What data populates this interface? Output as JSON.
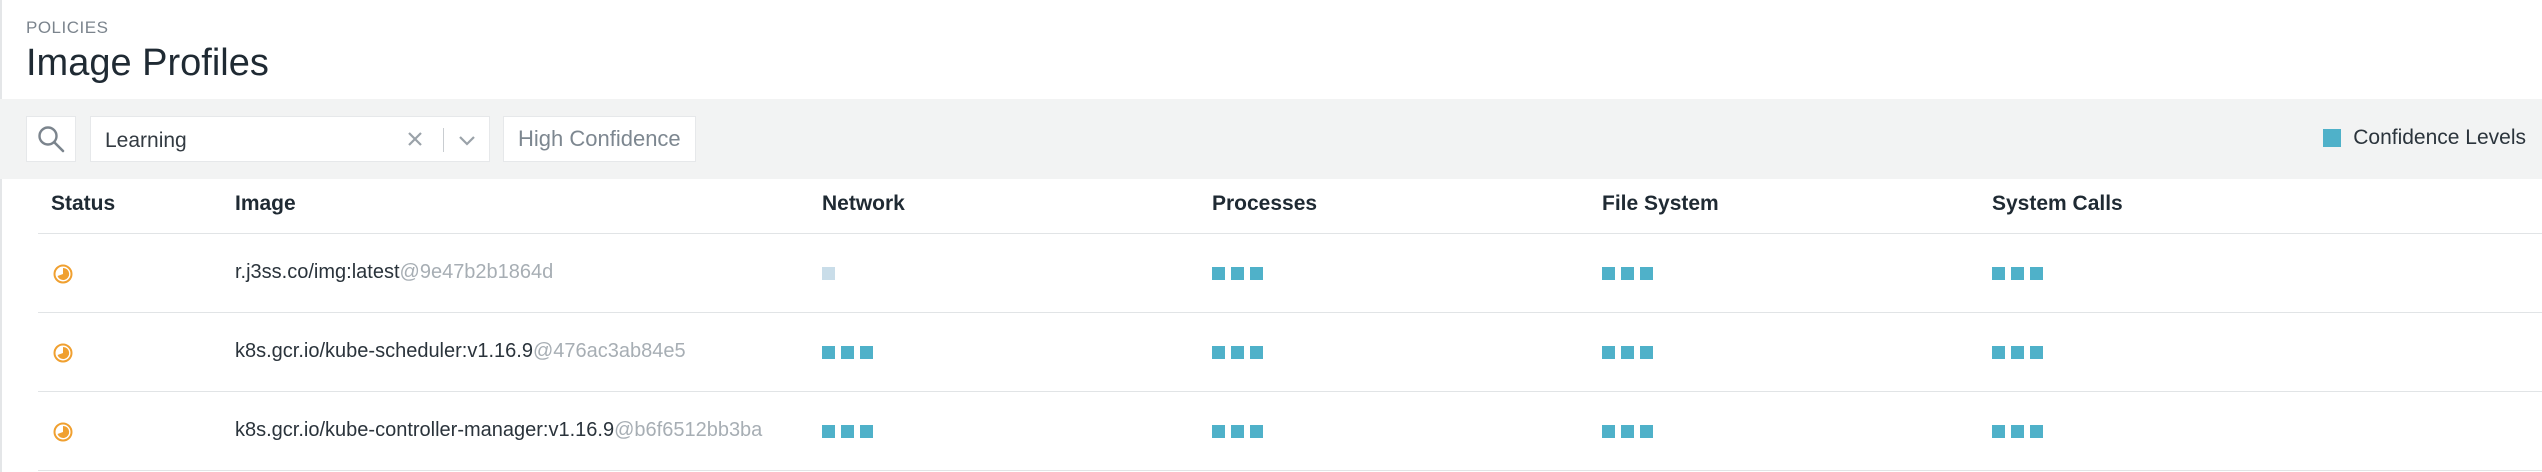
{
  "header": {
    "breadcrumb": "POLICIES",
    "title": "Image Profiles"
  },
  "toolbar": {
    "filter_value": "Learning",
    "confidence_button": "High Confidence",
    "legend_label": "Confidence Levels"
  },
  "colors": {
    "accent": "#4fb1c9",
    "low_confidence": "#c9dde9",
    "status_learning": "#f0a030"
  },
  "table": {
    "columns": [
      "Status",
      "Image",
      "Network",
      "Processes",
      "File System",
      "System Calls"
    ],
    "rows": [
      {
        "status": "learning",
        "image": "r.j3ss.co/img:latest",
        "hash": "@9e47b2b1864d",
        "network": 1,
        "processes": 3,
        "file_system": 3,
        "system_calls": 3
      },
      {
        "status": "learning",
        "image": "k8s.gcr.io/kube-scheduler:v1.16.9",
        "hash": "@476ac3ab84e5",
        "network": 3,
        "processes": 3,
        "file_system": 3,
        "system_calls": 3
      },
      {
        "status": "learning",
        "image": "k8s.gcr.io/kube-controller-manager:v1.16.9",
        "hash": "@b6f6512bb3ba",
        "network": 3,
        "processes": 3,
        "file_system": 3,
        "system_calls": 3
      }
    ]
  }
}
